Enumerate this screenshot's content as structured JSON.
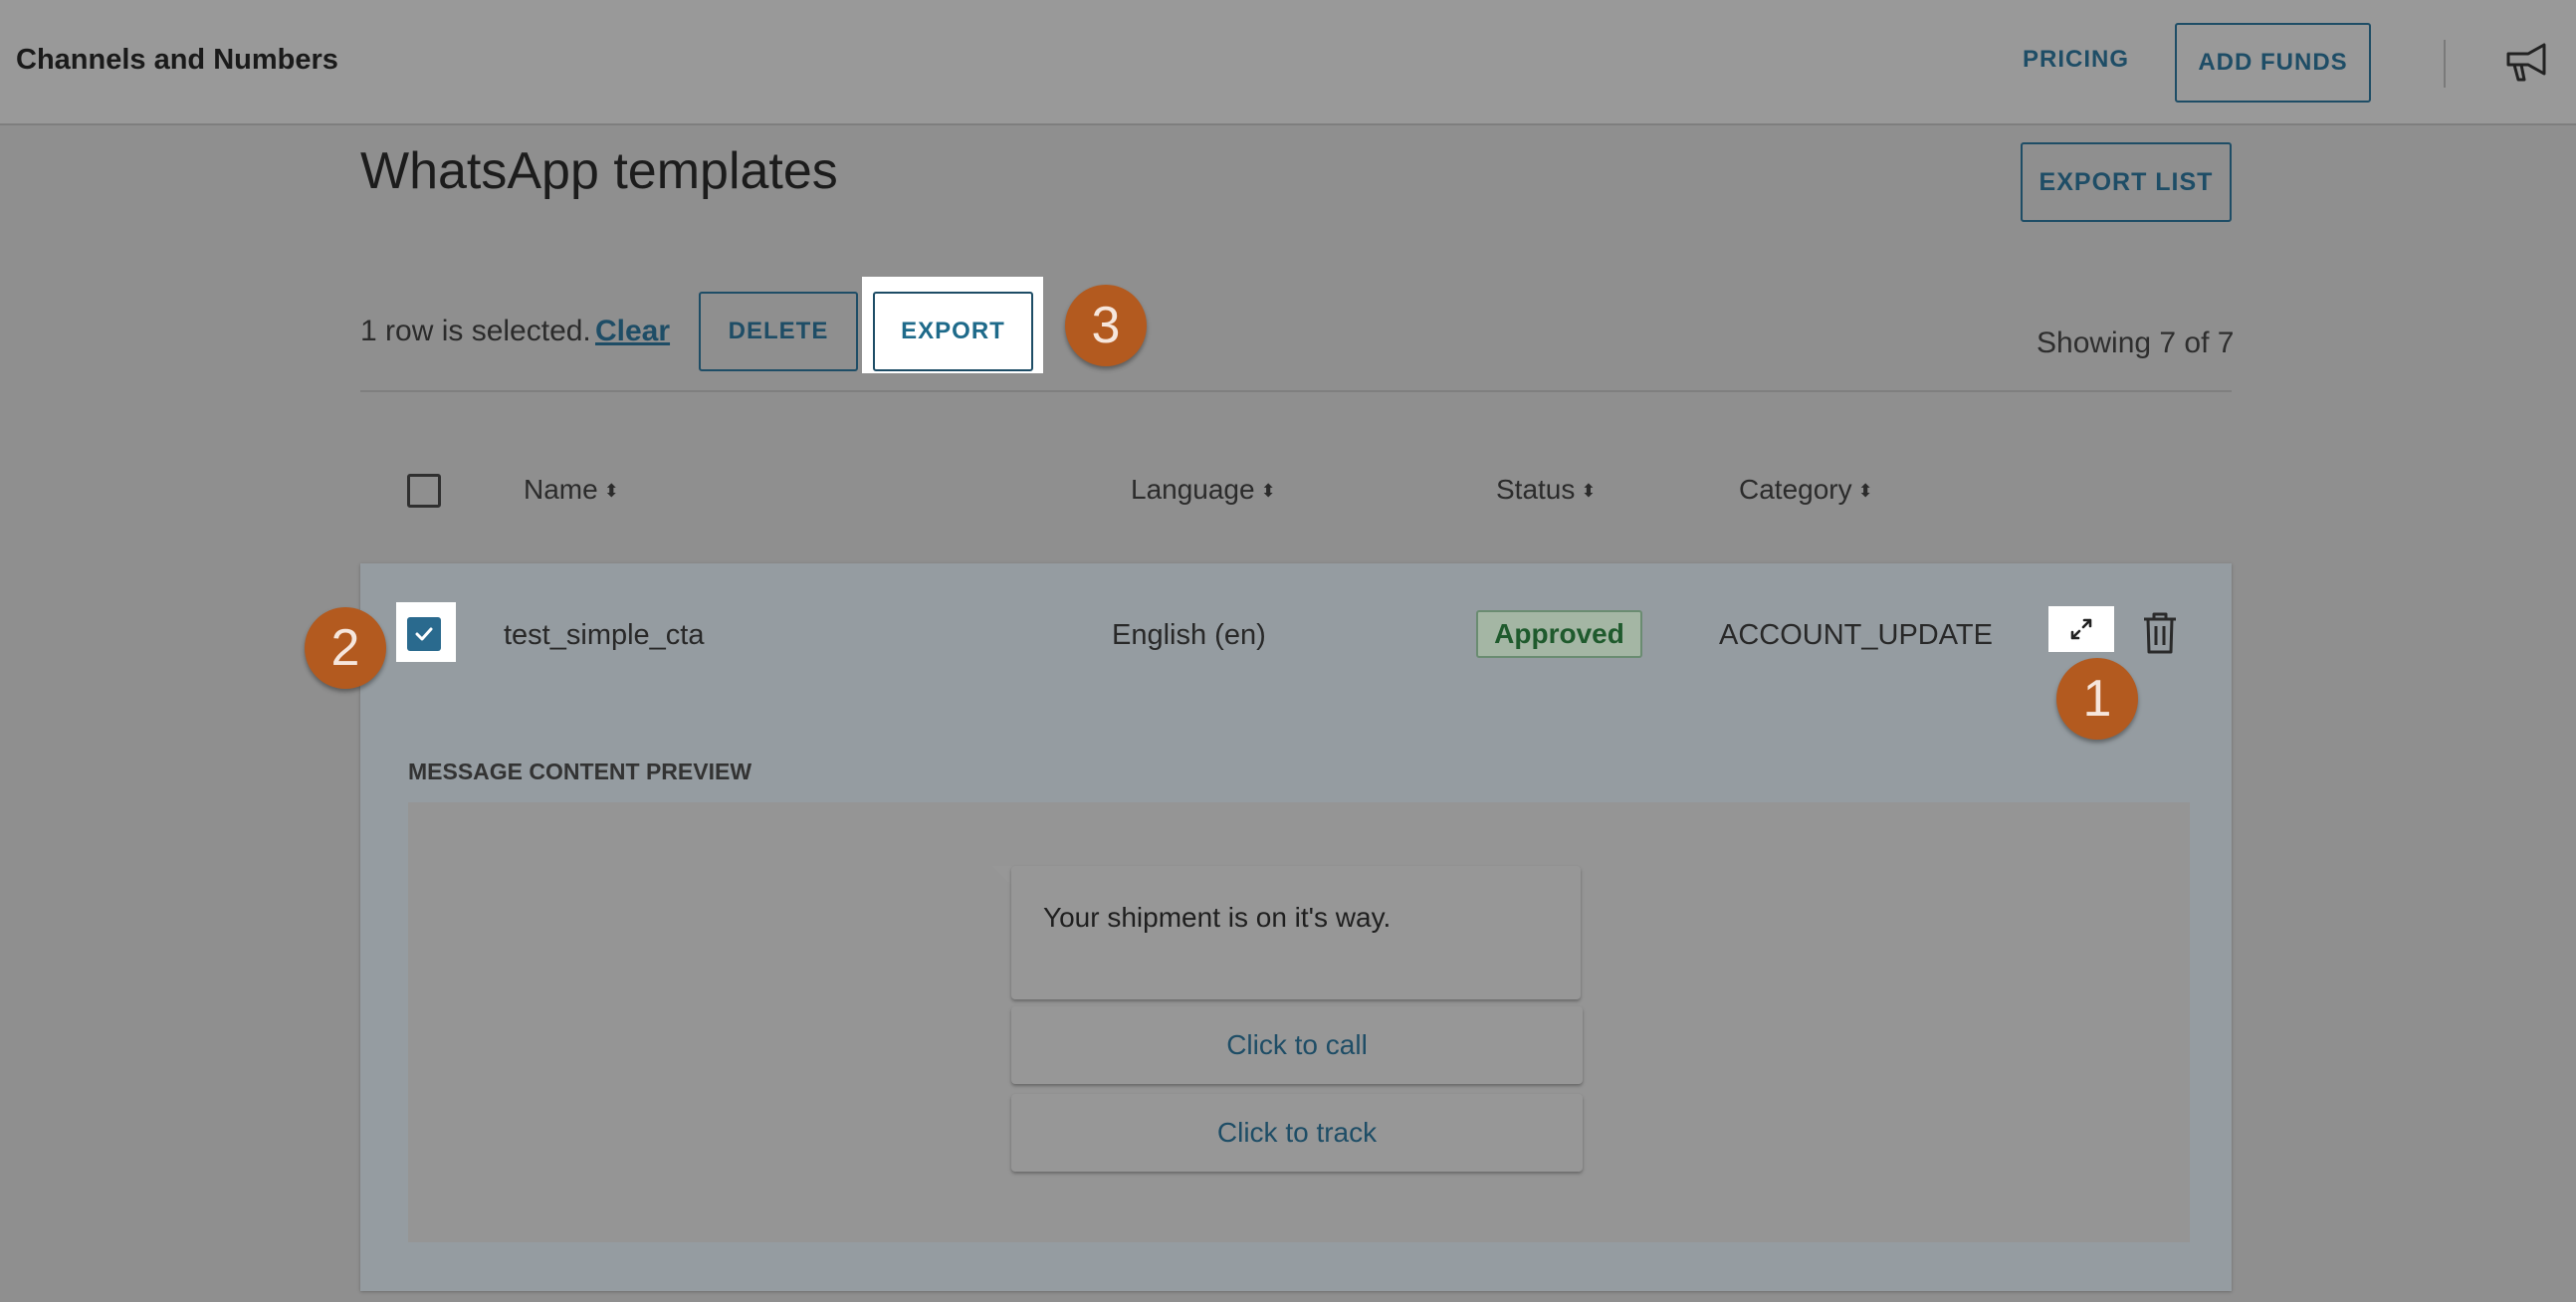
{
  "header": {
    "app_title": "Channels and Numbers",
    "pricing_label": "PRICING",
    "add_funds_label": "ADD FUNDS",
    "announcement_icon": "megaphone-icon"
  },
  "page": {
    "title": "WhatsApp templates",
    "export_list_label": "EXPORT LIST"
  },
  "selection_bar": {
    "selected_text": "1 row is selected.",
    "clear_label": "Clear",
    "delete_label": "DELETE",
    "export_label": "EXPORT",
    "showing_text": "Showing 7 of 7"
  },
  "annotations": [
    "1",
    "2",
    "3"
  ],
  "table": {
    "columns": [
      "Name",
      "Language",
      "Status",
      "Category"
    ],
    "rows": [
      {
        "name": "test_simple_cta",
        "language": "English (en)",
        "status": "Approved",
        "category": "ACCOUNT_UPDATE",
        "selected": true
      }
    ]
  },
  "preview": {
    "label": "MESSAGE CONTENT PREVIEW",
    "message": "Your shipment is on it's way.",
    "buttons": [
      "Click to call",
      "Click to track"
    ]
  },
  "colors": {
    "accent": "#1e4d66",
    "annotation": "#b35a1f",
    "approved": "#1f5a2d"
  }
}
